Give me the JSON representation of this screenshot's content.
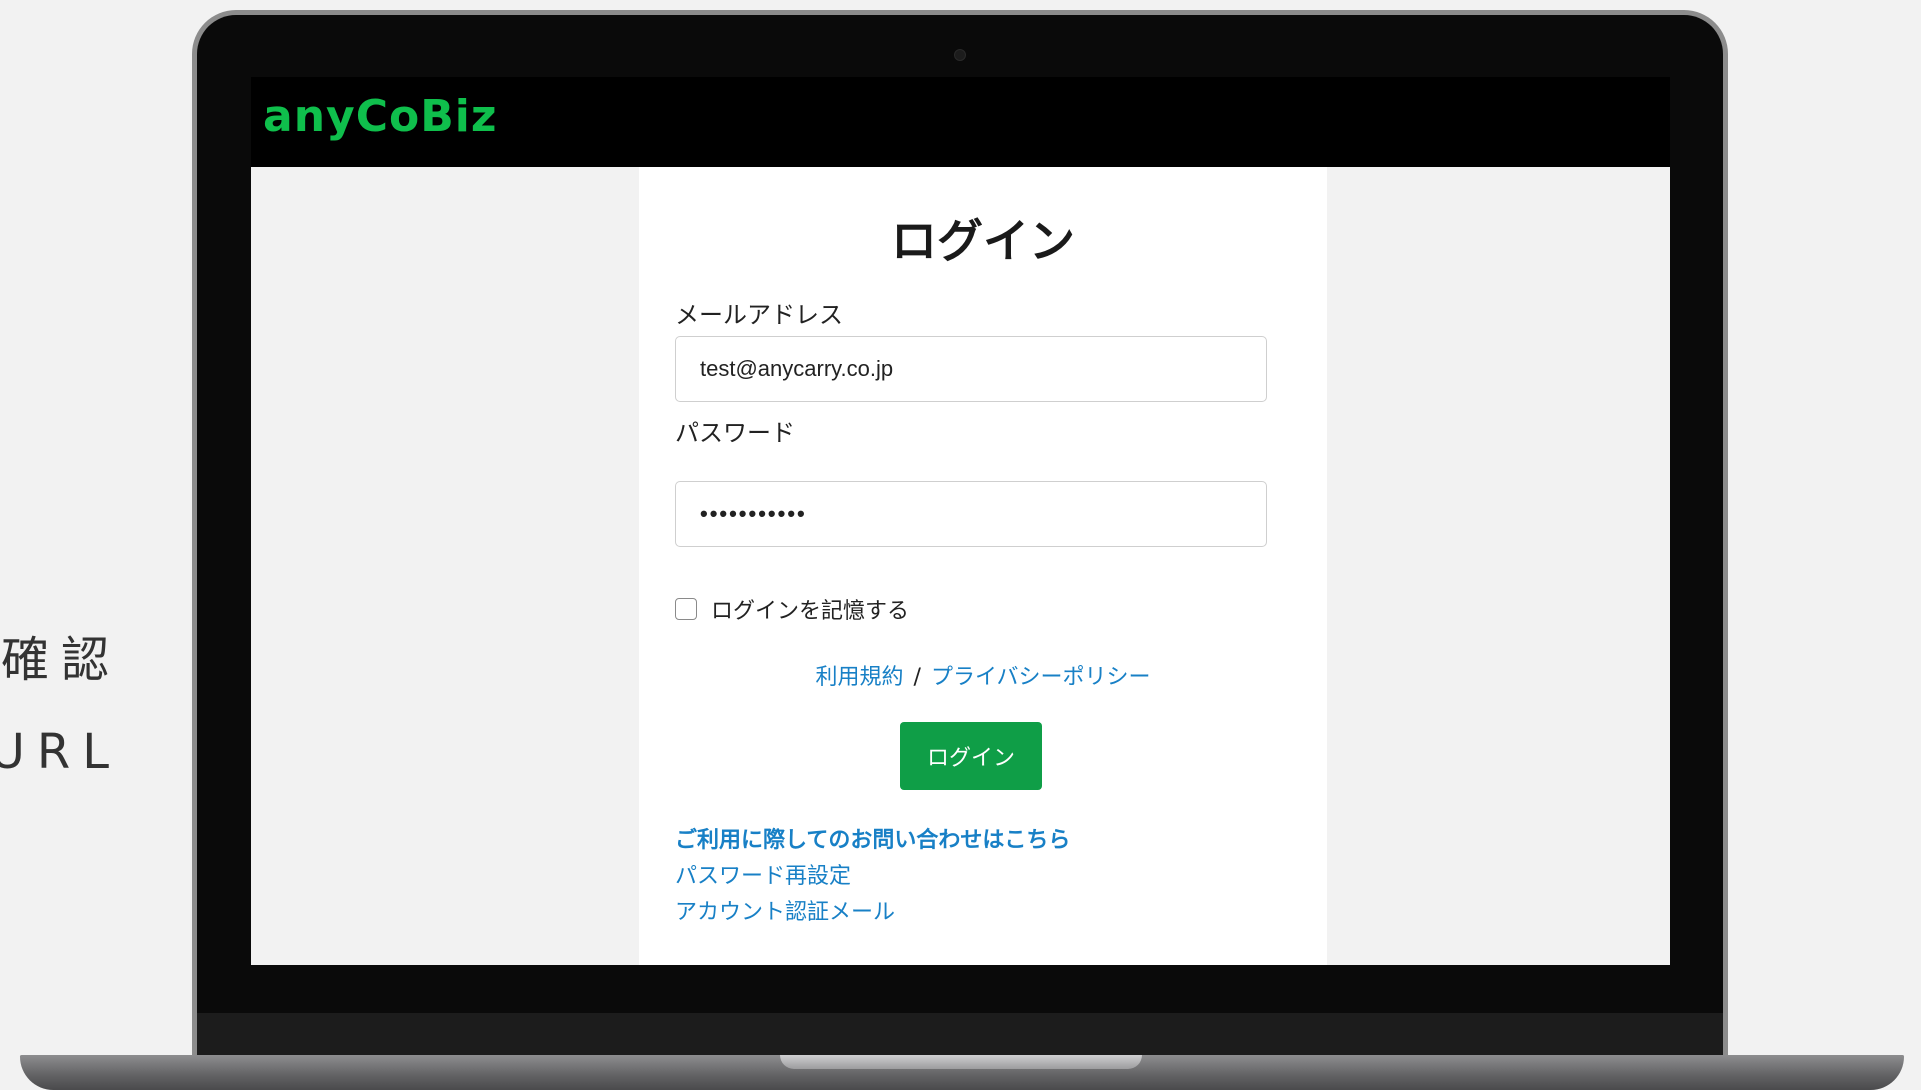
{
  "side_text": {
    "line1": "確認",
    "line2": "URL"
  },
  "header": {
    "logo": "anyCoBiz"
  },
  "login": {
    "title": "ログイン",
    "email_label": "メールアドレス",
    "email_value": "test@anycarry.co.jp",
    "password_label": "パスワード",
    "password_value": "•••••••••••",
    "remember_label": "ログインを記憶する",
    "remember_checked": false,
    "terms_link": "利用規約",
    "separator": "/",
    "privacy_link": "プライバシーポリシー",
    "submit_label": "ログイン",
    "contact_link": "ご利用に際してのお問い合わせはこちら",
    "reset_link": "パスワード再設定",
    "verify_link": "アカウント認証メール"
  },
  "colors": {
    "brand_green": "#0fbf4c",
    "button_green": "#0f9e47",
    "link_blue": "#1880c6"
  }
}
